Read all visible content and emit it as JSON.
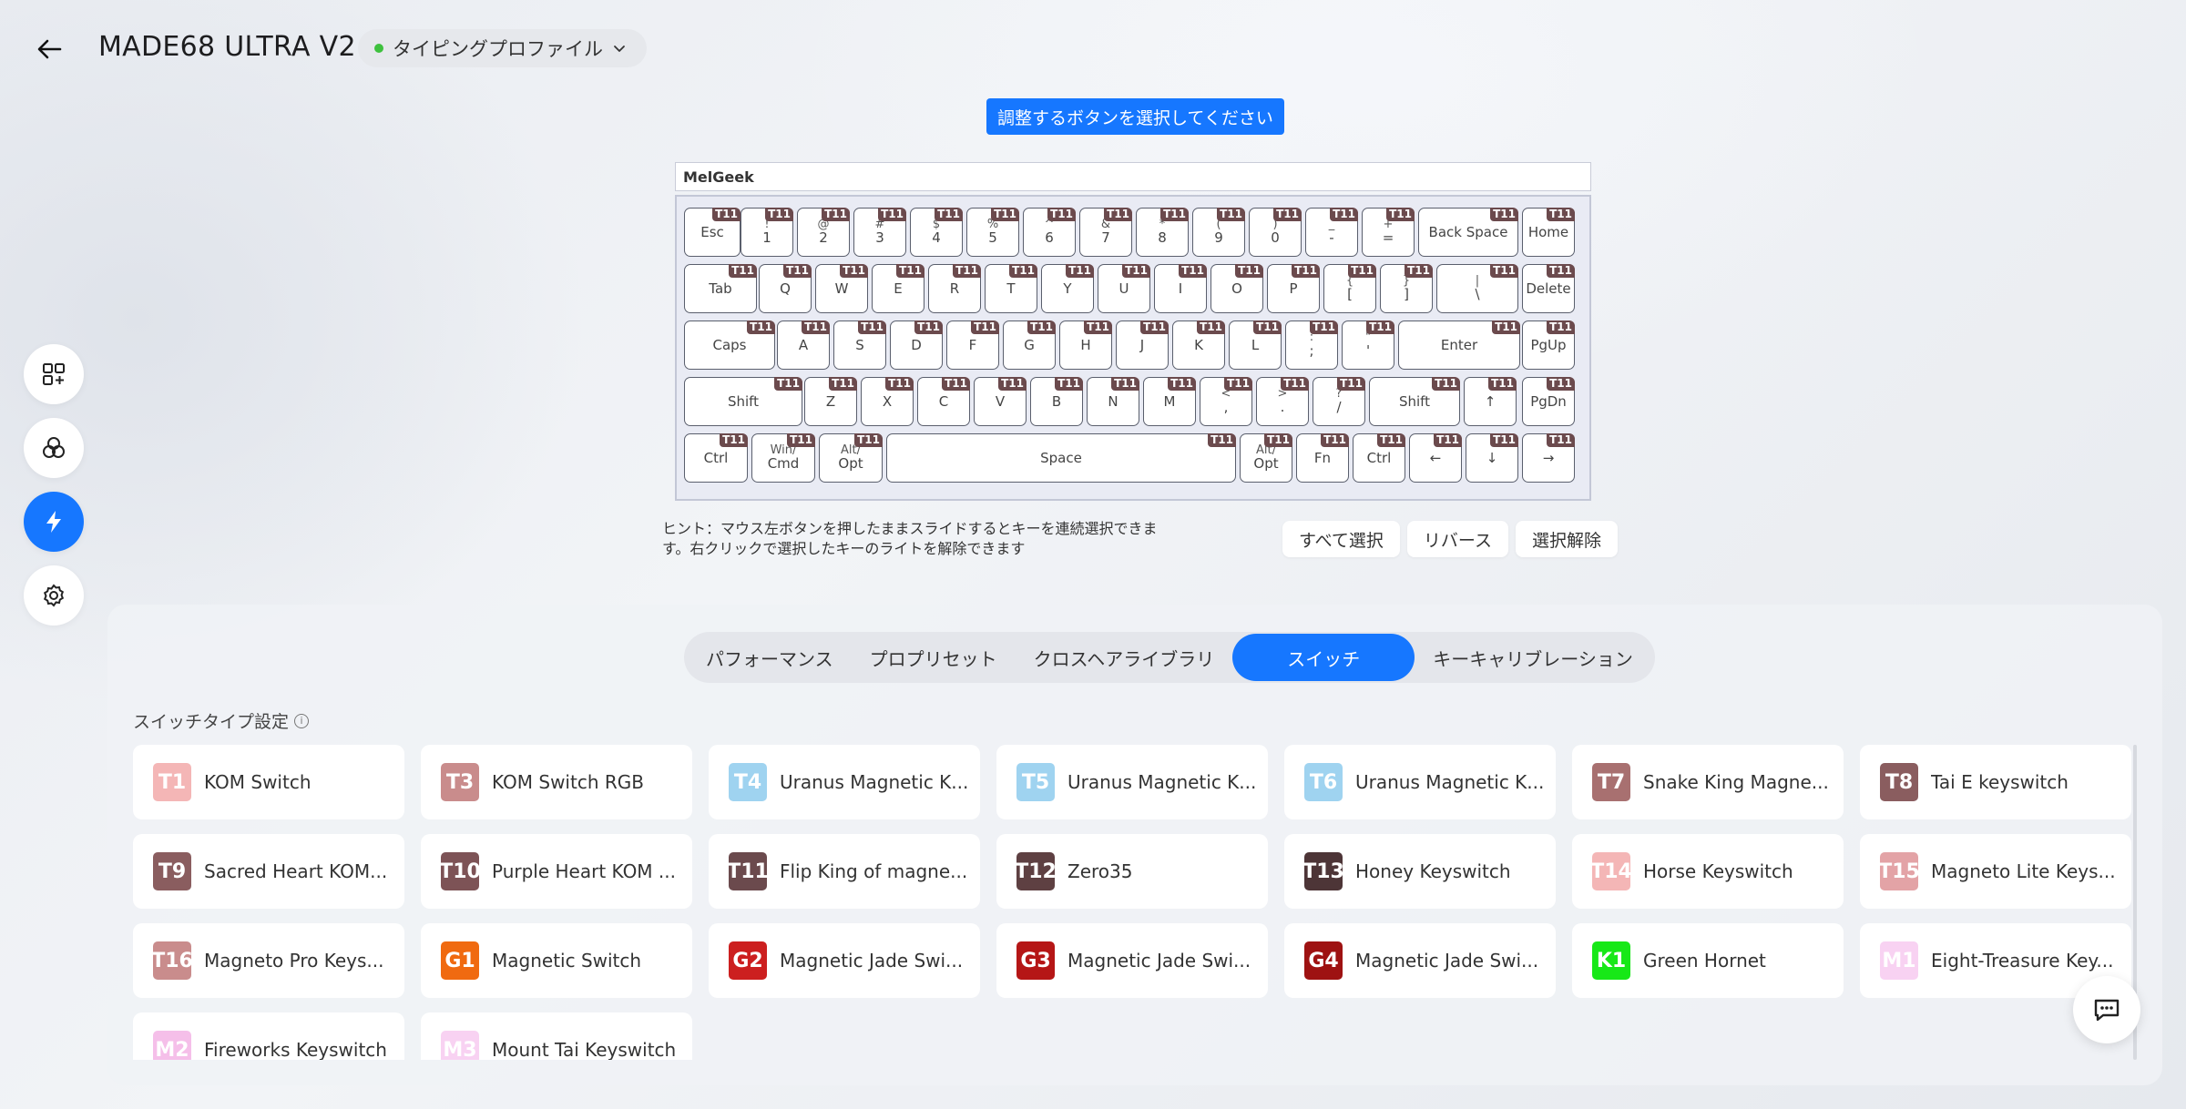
{
  "header": {
    "title": "MADE68 ULTRA V2",
    "profile": "タイピングプロファイル"
  },
  "keyboard": {
    "banner": "調整するボタンを選択してください",
    "brand": "MelGeek",
    "tag": "T11",
    "rows": [
      [
        [
          "",
          "Esc"
        ],
        [
          "!",
          "1"
        ],
        [
          "@",
          "2"
        ],
        [
          "#",
          "3"
        ],
        [
          "$",
          "4"
        ],
        [
          "%",
          "5"
        ],
        [
          "^",
          "6"
        ],
        [
          "&",
          "7"
        ],
        [
          "*",
          "8"
        ],
        [
          "(",
          "9"
        ],
        [
          ")",
          "0"
        ],
        [
          "_",
          "-"
        ],
        [
          "+",
          "="
        ],
        [
          "",
          "Back Space"
        ],
        [
          "",
          "Home"
        ]
      ],
      [
        [
          "",
          "Tab"
        ],
        [
          "",
          "Q"
        ],
        [
          "",
          "W"
        ],
        [
          "",
          "E"
        ],
        [
          "",
          "R"
        ],
        [
          "",
          "T"
        ],
        [
          "",
          "Y"
        ],
        [
          "",
          "U"
        ],
        [
          "",
          "I"
        ],
        [
          "",
          "O"
        ],
        [
          "",
          "P"
        ],
        [
          "{",
          "["
        ],
        [
          "}",
          "]"
        ],
        [
          "|",
          "\\"
        ],
        [
          "",
          "Delete"
        ]
      ],
      [
        [
          "",
          "Caps"
        ],
        [
          "",
          "A"
        ],
        [
          "",
          "S"
        ],
        [
          "",
          "D"
        ],
        [
          "",
          "F"
        ],
        [
          "",
          "G"
        ],
        [
          "",
          "H"
        ],
        [
          "",
          "J"
        ],
        [
          "",
          "K"
        ],
        [
          "",
          "L"
        ],
        [
          ":",
          ";"
        ],
        [
          "\"",
          "'"
        ],
        [
          "",
          "Enter"
        ],
        [
          "",
          "PgUp"
        ]
      ],
      [
        [
          "",
          "Shift"
        ],
        [
          "",
          "Z"
        ],
        [
          "",
          "X"
        ],
        [
          "",
          "C"
        ],
        [
          "",
          "V"
        ],
        [
          "",
          "B"
        ],
        [
          "",
          "N"
        ],
        [
          "",
          "M"
        ],
        [
          "<",
          ","
        ],
        [
          ">",
          "."
        ],
        [
          "?",
          "/"
        ],
        [
          "",
          "Shift"
        ],
        [
          "",
          "↑"
        ],
        [
          "",
          "PgDn"
        ]
      ],
      [
        [
          "",
          "Ctrl"
        ],
        [
          "Win/",
          "Cmd"
        ],
        [
          "Alt/",
          "Opt"
        ],
        [
          "",
          "Space"
        ],
        [
          "Alt/",
          "Opt"
        ],
        [
          "",
          "Fn"
        ],
        [
          "",
          "Ctrl"
        ],
        [
          "",
          "←"
        ],
        [
          "",
          "↓"
        ],
        [
          "",
          "→"
        ]
      ]
    ],
    "hint": "ヒント：マウス左ボタンを押したままスライドするとキーを連続選択できます。右クリックで選択したキーのライトを解除できます",
    "actions": {
      "select_all": "すべて選択",
      "reverse": "リバース",
      "deselect": "選択解除"
    }
  },
  "tabs": [
    "パフォーマンス",
    "プロプリセット",
    "クロスヘアライブラリ",
    "スイッチ",
    "キーキャリブレーション"
  ],
  "active_tab": "スイッチ",
  "section_label": "スイッチタイプ設定",
  "switches": [
    {
      "code": "T1",
      "name": "KOM Switch",
      "color": "#f4b6b6"
    },
    {
      "code": "T3",
      "name": "KOM Switch RGB",
      "color": "#c98c8c"
    },
    {
      "code": "T4",
      "name": "Uranus Magnetic K...",
      "color": "#9fd3f0"
    },
    {
      "code": "T5",
      "name": "Uranus Magnetic K...",
      "color": "#9fd3f0"
    },
    {
      "code": "T6",
      "name": "Uranus Magnetic K...",
      "color": "#9fd3f0"
    },
    {
      "code": "T7",
      "name": "Snake King Magne...",
      "color": "#a87070"
    },
    {
      "code": "T8",
      "name": "Tai E keyswitch",
      "color": "#8a5d5f"
    },
    {
      "code": "T9",
      "name": "Sacred Heart KOM...",
      "color": "#8a5d5f"
    },
    {
      "code": "T10",
      "name": "Purple Heart KOM ...",
      "color": "#7d5356"
    },
    {
      "code": "T11",
      "name": "Flip King of magne...",
      "color": "#6b4a4d"
    },
    {
      "code": "T12",
      "name": "Zero35",
      "color": "#5e4042"
    },
    {
      "code": "T13",
      "name": "Honey Keyswitch",
      "color": "#4d3537"
    },
    {
      "code": "T14",
      "name": "Horse Keyswitch",
      "color": "#f4b6b6"
    },
    {
      "code": "T15",
      "name": "Magneto Lite Keys...",
      "color": "#e3a3a6"
    },
    {
      "code": "T16",
      "name": "Magneto Pro Keys...",
      "color": "#c98c8c"
    },
    {
      "code": "G1",
      "name": "Magnetic Switch",
      "color": "#f06a10"
    },
    {
      "code": "G2",
      "name": "Magnetic Jade Swi...",
      "color": "#cc1f1f"
    },
    {
      "code": "G3",
      "name": "Magnetic Jade Swi...",
      "color": "#b51616"
    },
    {
      "code": "G4",
      "name": "Magnetic Jade Swi...",
      "color": "#9e1212"
    },
    {
      "code": "K1",
      "name": "Green Hornet",
      "color": "#17e817"
    },
    {
      "code": "M1",
      "name": "Eight-Treasure Key...",
      "color": "#f8d2f2"
    },
    {
      "code": "M2",
      "name": "Fireworks Keyswitch",
      "color": "#f5bfe9"
    },
    {
      "code": "M3",
      "name": "Mount Tai Keyswitch",
      "color": "#f8d2f2"
    }
  ]
}
